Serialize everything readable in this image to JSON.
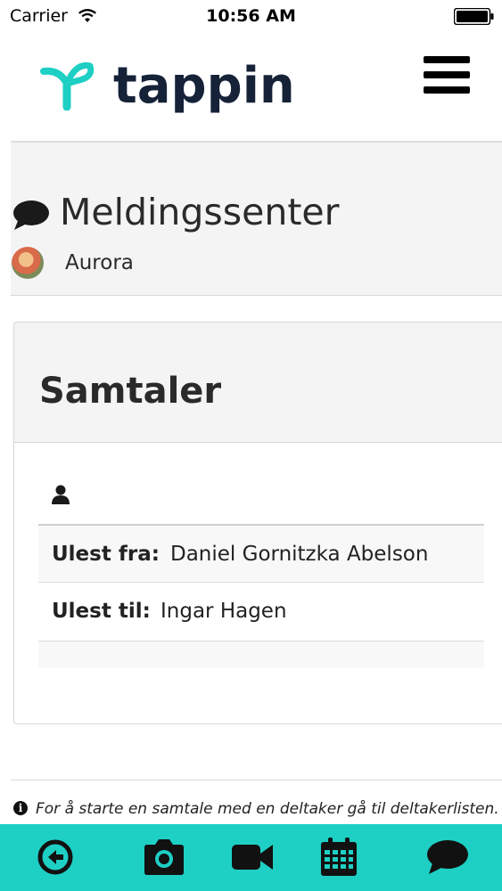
{
  "status_bar": {
    "carrier": "Carrier",
    "time": "10:56 AM"
  },
  "header": {
    "logo_text": "tappin",
    "brand_color": "#1ecfc4"
  },
  "message_center": {
    "title": "Meldingssenter",
    "user_name": "Aurora"
  },
  "conversations": {
    "title": "Samtaler",
    "rows": [
      {
        "label": "Ulest fra:",
        "value": "Daniel Gornitzka Abelson"
      },
      {
        "label": "Ulest til:",
        "value": "Ingar Hagen"
      }
    ]
  },
  "info_note": {
    "text": "For å starte en samtale med en deltaker gå til deltakerlisten. På"
  },
  "tab_bar": {
    "icons": [
      "back-arrow-icon",
      "camera-icon",
      "video-camera-icon",
      "calendar-icon",
      "chat-bubble-icon"
    ]
  }
}
